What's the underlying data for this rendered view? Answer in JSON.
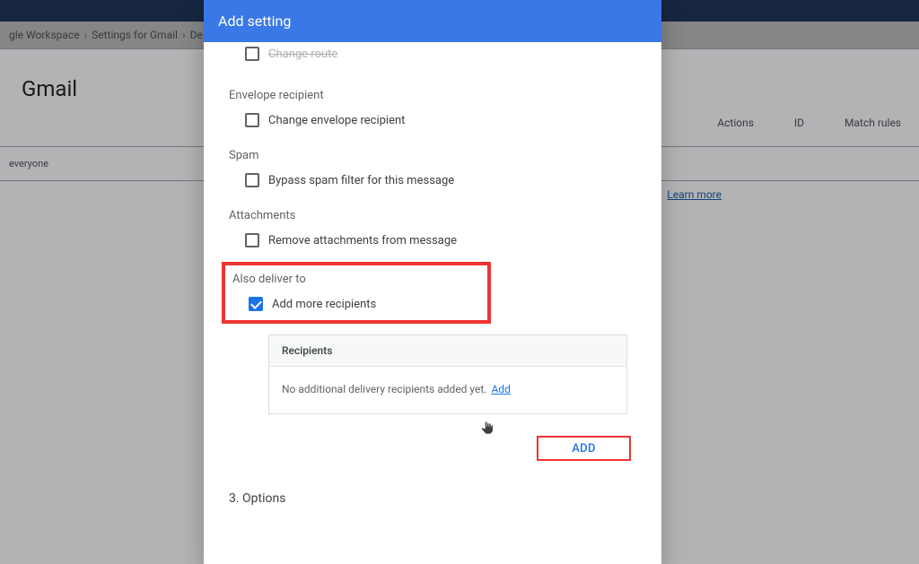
{
  "breadcrumb": {
    "item1": "gle Workspace",
    "item2": "Settings for Gmail",
    "item3": "De"
  },
  "page": {
    "title": "Gmail",
    "everyone": "everyone",
    "col_actions": "Actions",
    "col_id": "ID",
    "col_match": "Match rules",
    "learn_more": "Learn more"
  },
  "modal": {
    "title": "Add setting",
    "change_route": "Change route",
    "envelope_section": "Envelope recipient",
    "envelope_cb": "Change envelope recipient",
    "spam_section": "Spam",
    "spam_cb": "Bypass spam filter for this message",
    "attach_section": "Attachments",
    "attach_cb": "Remove attachments from message",
    "deliver_section": "Also deliver to",
    "deliver_cb": "Add more recipients",
    "recipients_header": "Recipients",
    "recipients_empty": "No additional delivery recipients added yet.",
    "add_link": "Add",
    "add_button": "ADD",
    "options_step": "3. Options"
  }
}
